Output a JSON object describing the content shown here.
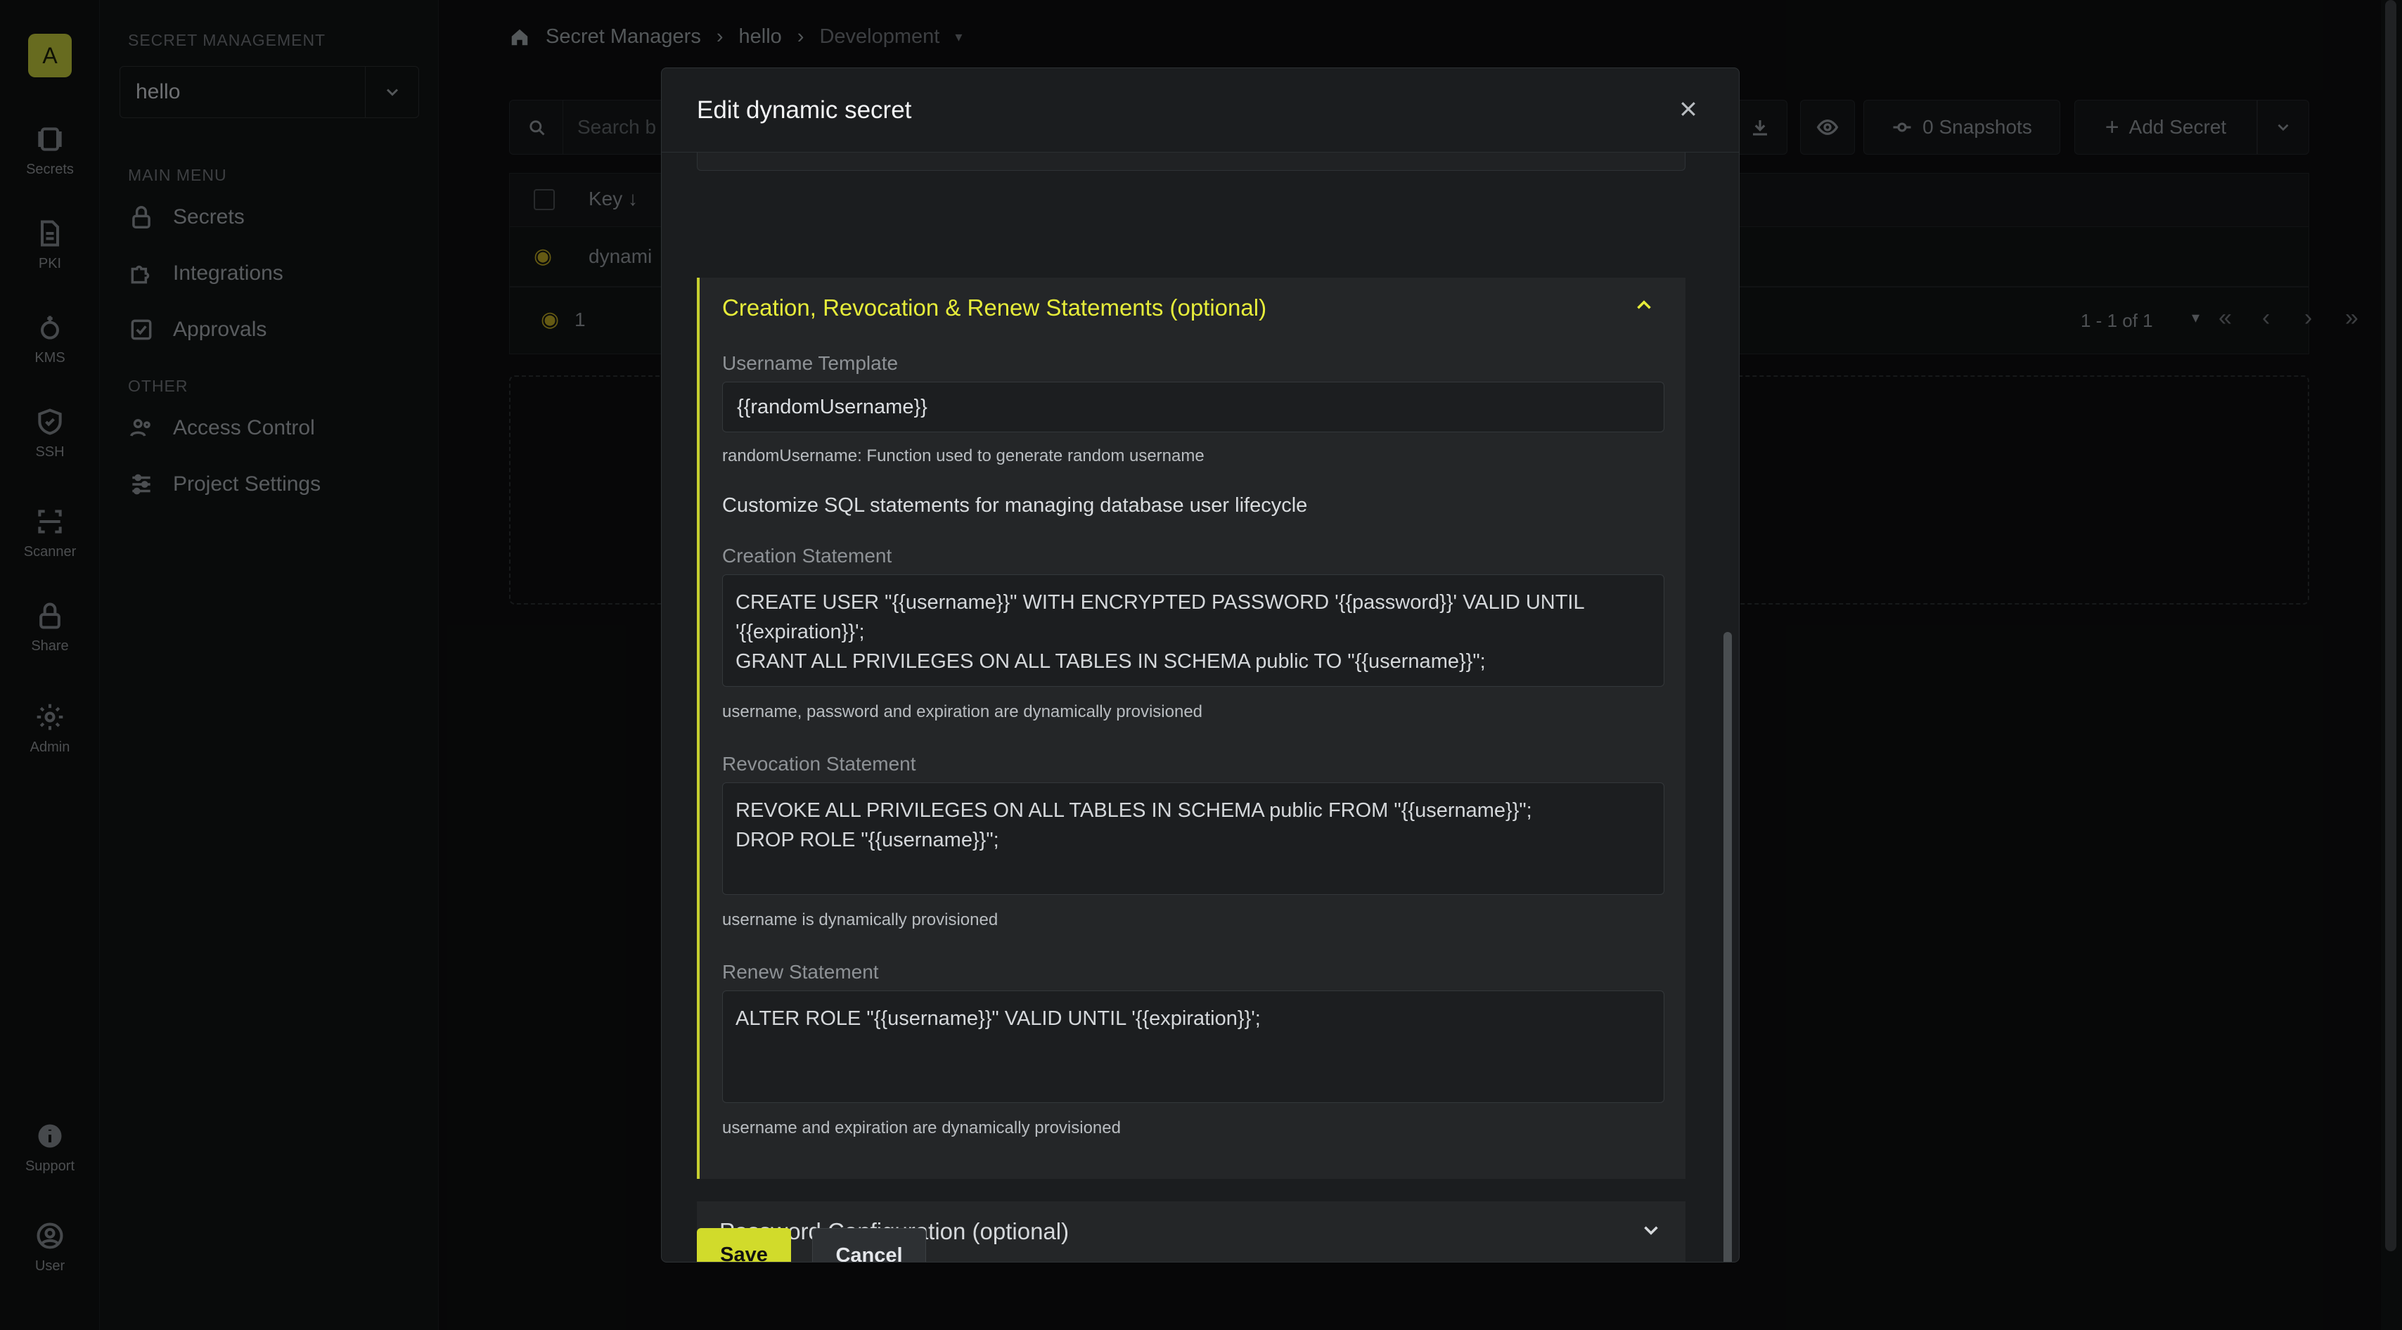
{
  "rail": {
    "org_initial": "A",
    "items": [
      {
        "label": "Secrets",
        "icon": "secrets-icon"
      },
      {
        "label": "PKI",
        "icon": "document-icon"
      },
      {
        "label": "KMS",
        "icon": "key-icon"
      },
      {
        "label": "SSH",
        "icon": "shield-icon"
      },
      {
        "label": "Scanner",
        "icon": "scanner-icon"
      },
      {
        "label": "Share",
        "icon": "lock-icon"
      },
      {
        "label": "Admin",
        "icon": "gear-icon"
      },
      {
        "label": "Support",
        "icon": "info-icon"
      },
      {
        "label": "User",
        "icon": "user-icon"
      }
    ]
  },
  "sidebar": {
    "section_title": "SECRET MANAGEMENT",
    "project": "hello",
    "main_menu_title": "MAIN MENU",
    "main_items": [
      {
        "label": "Secrets",
        "icon": "lock-icon"
      },
      {
        "label": "Integrations",
        "icon": "puzzle-icon"
      },
      {
        "label": "Approvals",
        "icon": "check-square-icon"
      }
    ],
    "other_title": "OTHER",
    "other_items": [
      {
        "label": "Access Control",
        "icon": "users-icon"
      },
      {
        "label": "Project Settings",
        "icon": "sliders-icon"
      }
    ]
  },
  "breadcrumb": {
    "root": "Secret Managers",
    "project": "hello",
    "environment": "Development"
  },
  "toolbar": {
    "search_placeholder": "Search b",
    "snapshots": "0 Snapshots",
    "add_secret": "Add Secret"
  },
  "table": {
    "key_header": "Key",
    "row_key": "dynami",
    "footer_count": "1",
    "pagination": "1 - 1 of 1"
  },
  "modal": {
    "title": "Edit dynamic secret",
    "section_title": "Creation, Revocation & Renew Statements (optional)",
    "username_template_label": "Username Template",
    "username_template_value": "{{randomUsername}}",
    "username_template_help": "randomUsername: Function used to generate random username",
    "section_description": "Customize SQL statements for managing database user lifecycle",
    "creation_label": "Creation Statement",
    "creation_value": "CREATE USER \"{{username}}\" WITH ENCRYPTED PASSWORD '{{password}}' VALID UNTIL '{{expiration}}';\nGRANT ALL PRIVILEGES ON ALL TABLES IN SCHEMA public TO \"{{username}}\";",
    "creation_help": "username, password and expiration are dynamically provisioned",
    "revocation_label": "Revocation Statement",
    "revocation_value": "REVOKE ALL PRIVILEGES ON ALL TABLES IN SCHEMA public FROM \"{{username}}\";\nDROP ROLE \"{{username}}\";",
    "revocation_help": "username is dynamically provisioned",
    "renew_label": "Renew Statement",
    "renew_value": "ALTER ROLE \"{{username}}\" VALID UNTIL '{{expiration}}';",
    "renew_help": "username and expiration are dynamically provisioned",
    "password_section_title": "Password Configuration (optional)",
    "save_label": "Save",
    "cancel_label": "Cancel"
  },
  "colors": {
    "accent": "#d1db2b",
    "section_title": "#e6ec3a",
    "background": "#0a0b0c",
    "modal_bg": "#1b1d1f"
  }
}
